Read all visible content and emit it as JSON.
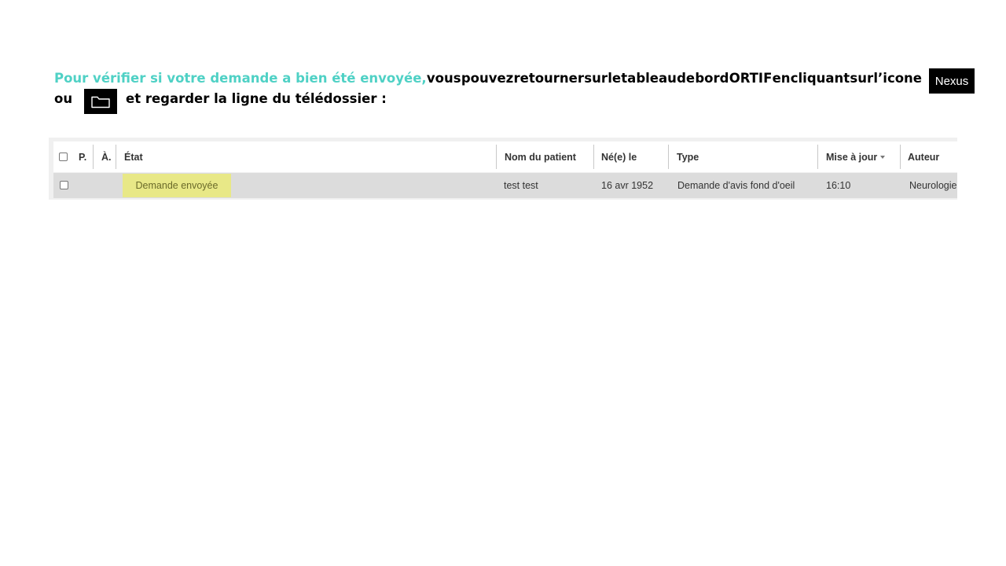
{
  "instruction": {
    "highlight": "Pour vérifier si votre demande a bien été envoyée,",
    "line1_words": [
      "vous",
      "pouvez",
      "retourner",
      "sur",
      "le",
      "tableau",
      "de",
      "bord",
      "ORTIF",
      "en",
      "cliquant",
      "sur",
      "l’icone"
    ],
    "line2_ou": "ou",
    "line2_rest": "et regarder la ligne du télédossier :",
    "nexus_label": "Nexus",
    "folder_icon": "folder-icon"
  },
  "table": {
    "headers": {
      "p": "P.",
      "a": "À.",
      "etat": "État",
      "nom": "Nom du patient",
      "ne": "Né(e) le",
      "type": "Type",
      "maj": "Mise à jour",
      "auteur": "Auteur"
    },
    "sort_icon": "caret-down-icon",
    "rows": [
      {
        "etat": "Demande envoyée",
        "nom": "test test",
        "ne": "16 avr 1952",
        "type": "Demande d'avis fond d'oeil",
        "maj": "16:10",
        "auteur": "Neurologie"
      }
    ]
  },
  "colors": {
    "highlight_text": "#4fd1c5",
    "status_badge_bg": "#e8e887",
    "row_bg": "#dcdcdc",
    "badge_bg": "#000000"
  }
}
